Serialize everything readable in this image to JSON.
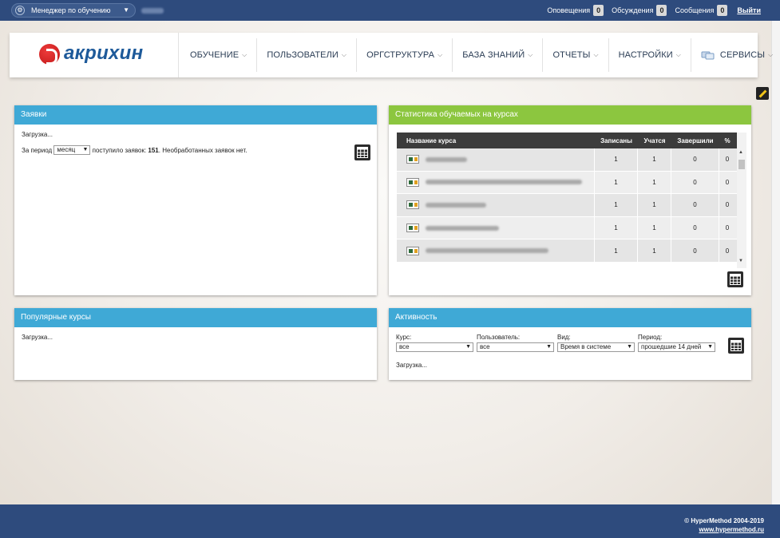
{
  "topbar": {
    "role": "Менеджер по обучению",
    "links": [
      {
        "label": "Оповещения",
        "count": "0"
      },
      {
        "label": "Обсуждения",
        "count": "0"
      },
      {
        "label": "Сообщения",
        "count": "0"
      }
    ],
    "logout": "Выйти"
  },
  "header": {
    "logo_text": "акрихин",
    "nav": [
      "ОБУЧЕНИЕ",
      "ПОЛЬЗОВАТЕЛИ",
      "ОРГСТРУКТУРА",
      "БАЗА ЗНАНИЙ",
      "ОТЧЕТЫ",
      "НАСТРОЙКИ",
      "СЕРВИСЫ"
    ]
  },
  "requests": {
    "title": "Заявки",
    "loading": "Загрузка...",
    "period_prefix": "За период",
    "period_value": "месяц",
    "received_text": "поступило заявок:",
    "received_count": "151",
    "unprocessed_text": ". Необработанных заявок нет."
  },
  "stats": {
    "title": "Статистика обучаемых на курсах",
    "columns": [
      "Название курса",
      "Записаны",
      "Учатся",
      "Завершили",
      "%"
    ],
    "rows": [
      {
        "enrolled": "1",
        "studying": "1",
        "completed": "0",
        "percent": "0"
      },
      {
        "enrolled": "1",
        "studying": "1",
        "completed": "0",
        "percent": "0"
      },
      {
        "enrolled": "1",
        "studying": "1",
        "completed": "0",
        "percent": "0"
      },
      {
        "enrolled": "1",
        "studying": "1",
        "completed": "0",
        "percent": "0"
      },
      {
        "enrolled": "1",
        "studying": "1",
        "completed": "0",
        "percent": "0"
      }
    ]
  },
  "popular": {
    "title": "Популярные курсы",
    "loading": "Загрузка..."
  },
  "activity": {
    "title": "Активность",
    "fields": [
      {
        "label": "Курс:",
        "value": "все"
      },
      {
        "label": "Пользователь:",
        "value": "все"
      },
      {
        "label": "Вид:",
        "value": "Время в системе"
      },
      {
        "label": "Период:",
        "value": "прошедшие 14 дней"
      }
    ],
    "loading": "Загрузка..."
  },
  "footer": {
    "copyright": "© HyperMethod 2004-2019",
    "site": "www.hypermethod.ru"
  }
}
